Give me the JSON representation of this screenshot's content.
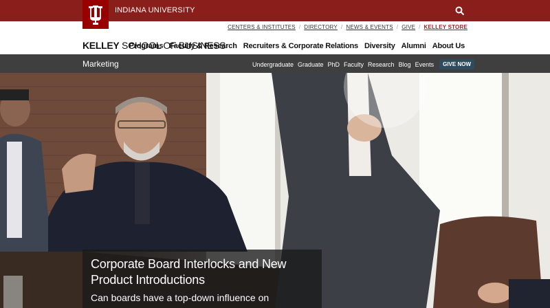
{
  "iu_bar": {
    "name": "INDIANA UNIVERSITY"
  },
  "utility_links": [
    {
      "label": "CENTERS & INSTITUTES"
    },
    {
      "label": "DIRECTORY"
    },
    {
      "label": "NEWS & EVENTS"
    },
    {
      "label": "GIVE"
    },
    {
      "label": "KELLEY STORE"
    }
  ],
  "school": {
    "bold": "KELLEY",
    "rest": " SCHOOL OF BUSINESS"
  },
  "main_nav": [
    "Programs",
    "Faculty & Research",
    "Recruiters & Corporate Relations",
    "Diversity",
    "Alumni",
    "About Us"
  ],
  "section": {
    "title": "Marketing"
  },
  "sub_nav": [
    "Undergraduate",
    "Graduate",
    "PhD",
    "Faculty",
    "Research",
    "Blog",
    "Events"
  ],
  "give_now": "GIVE NOW",
  "caption": {
    "title": "Corporate Board Interlocks and New Product Introductions",
    "subtitle": "Can boards have a top-down influence on"
  },
  "colors": {
    "iu_crimson": "#990000",
    "section_bar": "#3f3f3f",
    "give_now": "#2f4c5e"
  },
  "icons": {
    "search": "search-icon",
    "logo": "iu-trident-logo"
  }
}
